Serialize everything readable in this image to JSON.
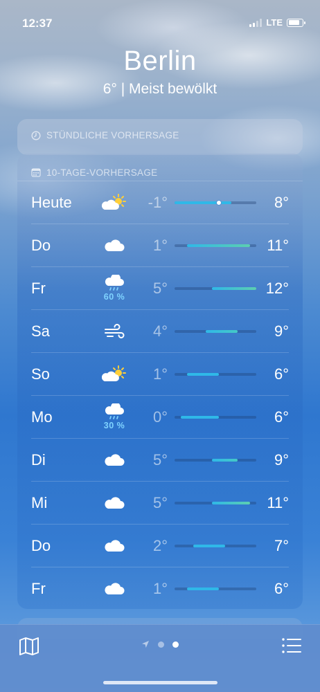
{
  "status_bar": {
    "time": "12:37",
    "network": "LTE"
  },
  "header": {
    "city": "Berlin",
    "condition": "6° | Meist bewölkt"
  },
  "hourly": {
    "title": "STÜNDLICHE VORHERSAGE",
    "icon": "clock-icon"
  },
  "daily": {
    "title": "10-TAGE-VORHERSAGE",
    "icon": "calendar-icon",
    "range_min": -1,
    "range_max": 12,
    "current_temp": 6,
    "days": [
      {
        "day": "Heute",
        "icon": "partly-sunny-icon",
        "precip": "",
        "low": "-1°",
        "high": "8°",
        "low_val": -1,
        "high_val": 8
      },
      {
        "day": "Do",
        "icon": "cloud-icon",
        "precip": "",
        "low": "1°",
        "high": "11°",
        "low_val": 1,
        "high_val": 11
      },
      {
        "day": "Fr",
        "icon": "rain-cloud-icon",
        "precip": "60 %",
        "low": "5°",
        "high": "12°",
        "low_val": 5,
        "high_val": 12
      },
      {
        "day": "Sa",
        "icon": "wind-icon",
        "precip": "",
        "low": "4°",
        "high": "9°",
        "low_val": 4,
        "high_val": 9
      },
      {
        "day": "So",
        "icon": "partly-sunny-icon",
        "precip": "",
        "low": "1°",
        "high": "6°",
        "low_val": 1,
        "high_val": 6
      },
      {
        "day": "Mo",
        "icon": "rain-cloud-icon",
        "precip": "30 %",
        "low": "0°",
        "high": "6°",
        "low_val": 0,
        "high_val": 6
      },
      {
        "day": "Di",
        "icon": "cloud-icon",
        "precip": "",
        "low": "5°",
        "high": "9°",
        "low_val": 5,
        "high_val": 9
      },
      {
        "day": "Mi",
        "icon": "cloud-icon",
        "precip": "",
        "low": "5°",
        "high": "11°",
        "low_val": 5,
        "high_val": 11
      },
      {
        "day": "Do",
        "icon": "cloud-icon",
        "precip": "",
        "low": "2°",
        "high": "7°",
        "low_val": 2,
        "high_val": 7
      },
      {
        "day": "Fr",
        "icon": "cloud-icon",
        "precip": "",
        "low": "1°",
        "high": "6°",
        "low_val": 1,
        "high_val": 6
      }
    ]
  },
  "bottom_bar": {
    "map_icon": "map-icon",
    "list_icon": "list-icon",
    "location_icon": "location-arrow-icon",
    "pages": 2,
    "active_page": 2
  },
  "colors": {
    "bar_cold": "#2fb8e8",
    "bar_mild": "#45c9c6",
    "bar_warm": "#5ccfb0",
    "precip": "#7fd3ff"
  }
}
